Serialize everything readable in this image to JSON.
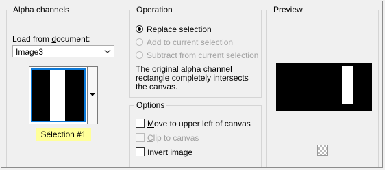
{
  "alpha_channels": {
    "title": "Alpha channels",
    "load_from_label_prefix": "Load from ",
    "load_from_label_underlined": "d",
    "load_from_label_suffix": "ocument:",
    "document_value": "Image3",
    "selection_name": "Sélection #1"
  },
  "operation": {
    "title": "Operation",
    "options": [
      {
        "prefix": "",
        "key": "R",
        "rest": "eplace selection",
        "checked": true,
        "enabled": true
      },
      {
        "prefix": "",
        "key": "A",
        "rest": "dd to current selection",
        "checked": false,
        "enabled": false
      },
      {
        "prefix": "",
        "key": "S",
        "rest": "ubtract from current selection",
        "checked": false,
        "enabled": false
      }
    ],
    "description": "The original alpha channel rectangle completely intersects the canvas."
  },
  "options": {
    "title": "Options",
    "items": [
      {
        "key": "M",
        "rest": "ove to upper left of canvas",
        "checked": false,
        "enabled": true
      },
      {
        "key": "C",
        "rest": "lip to canvas",
        "checked": false,
        "enabled": false
      },
      {
        "key": "I",
        "rest": "nvert image",
        "checked": false,
        "enabled": true
      }
    ]
  },
  "preview": {
    "title": "Preview",
    "icon": "checkerboard-icon"
  }
}
